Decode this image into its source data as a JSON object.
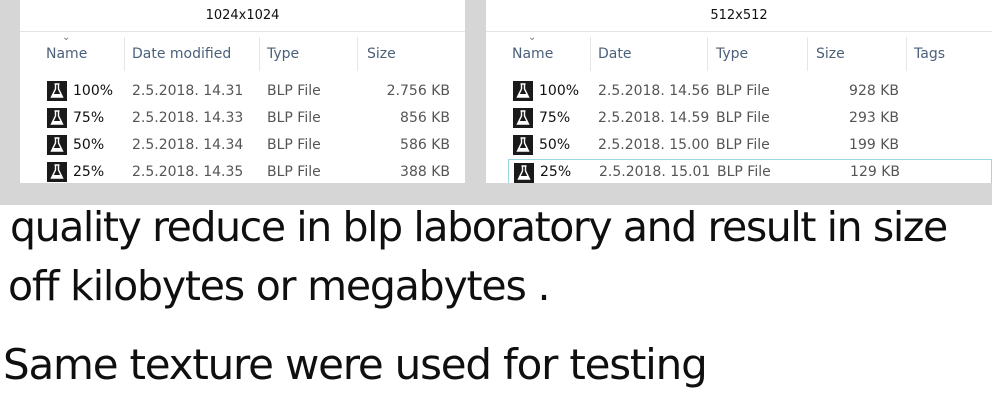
{
  "left_panel": {
    "title": "1024x1024",
    "headers": {
      "name": "Name",
      "date": "Date modified",
      "type": "Type",
      "size": "Size"
    },
    "files": [
      {
        "name": "100%",
        "date": "2.5.2018. 14.31",
        "type": "BLP File",
        "size": "2.756 KB",
        "icon": "flask-icon"
      },
      {
        "name": "75%",
        "date": "2.5.2018. 14.33",
        "type": "BLP File",
        "size": "856 KB",
        "icon": "flask-icon"
      },
      {
        "name": "50%",
        "date": "2.5.2018. 14.34",
        "type": "BLP File",
        "size": "586 KB",
        "icon": "flask-icon"
      },
      {
        "name": "25%",
        "date": "2.5.2018. 14.35",
        "type": "BLP File",
        "size": "388 KB",
        "icon": "flask-icon"
      }
    ]
  },
  "right_panel": {
    "title": "512x512",
    "headers": {
      "name": "Name",
      "date": "Date",
      "type": "Type",
      "size": "Size",
      "tags": "Tags"
    },
    "files": [
      {
        "name": "100%",
        "date": "2.5.2018. 14.56",
        "type": "BLP File",
        "size": "928 KB",
        "icon": "flask-icon"
      },
      {
        "name": "75%",
        "date": "2.5.2018. 14.59",
        "type": "BLP File",
        "size": "293 KB",
        "icon": "flask-icon"
      },
      {
        "name": "50%",
        "date": "2.5.2018. 15.00",
        "type": "BLP File",
        "size": "199 KB",
        "icon": "flask-icon"
      },
      {
        "name": "25%",
        "date": "2.5.2018. 15.01",
        "type": "BLP File",
        "size": "129 KB",
        "icon": "flask-icon"
      }
    ]
  },
  "caption": {
    "line1": "quality reduce in blp laboratory and result in size",
    "line2": "off kilobytes or megabytes .",
    "line3": "Same texture were used for testing"
  },
  "colors": {
    "background_band": "#d6d6d6",
    "header_text": "#4c607a",
    "selection_border": "#9ad7e0"
  }
}
